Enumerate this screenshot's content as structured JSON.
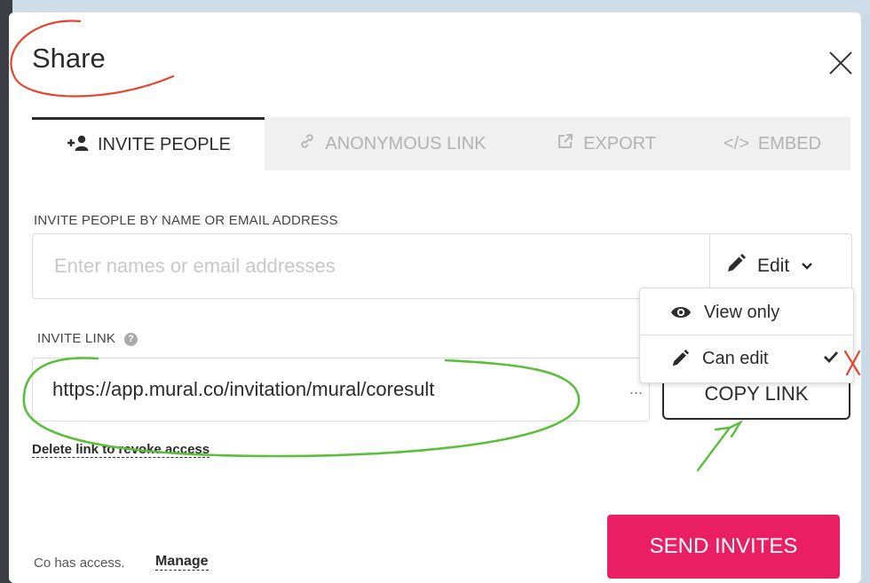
{
  "dialog": {
    "title": "Share",
    "close_icon": "close-icon"
  },
  "tabs": [
    {
      "label": "INVITE PEOPLE",
      "icon": "add-person-icon",
      "active": true
    },
    {
      "label": "ANONYMOUS LINK",
      "icon": "link-icon",
      "active": false
    },
    {
      "label": "EXPORT",
      "icon": "external-link-icon",
      "active": false
    },
    {
      "label": "EMBED",
      "icon": "code-icon",
      "active": false
    }
  ],
  "invite": {
    "label": "INVITE PEOPLE BY NAME OR EMAIL ADDRESS",
    "placeholder": "Enter names or email addresses",
    "value": "",
    "permission": "Edit"
  },
  "permission_menu": {
    "items": [
      {
        "label": "View only",
        "icon": "eye-icon",
        "selected": false
      },
      {
        "label": "Can edit",
        "icon": "pencil-icon",
        "selected": true
      }
    ]
  },
  "invite_link": {
    "label": "INVITE LINK",
    "help_icon": "?",
    "url": "https://app.mural.co/invitation/mural/coresult",
    "more": "...",
    "copy_label": "COPY LINK",
    "delete_label": "Delete link to revoke access"
  },
  "footer": {
    "access_text": "Co has access.",
    "manage_label": "Manage",
    "send_label": "SEND INVITES"
  },
  "colors": {
    "accent": "#ea1f63",
    "annotation_red": "#e8442d",
    "annotation_green": "#5cbf3c"
  }
}
